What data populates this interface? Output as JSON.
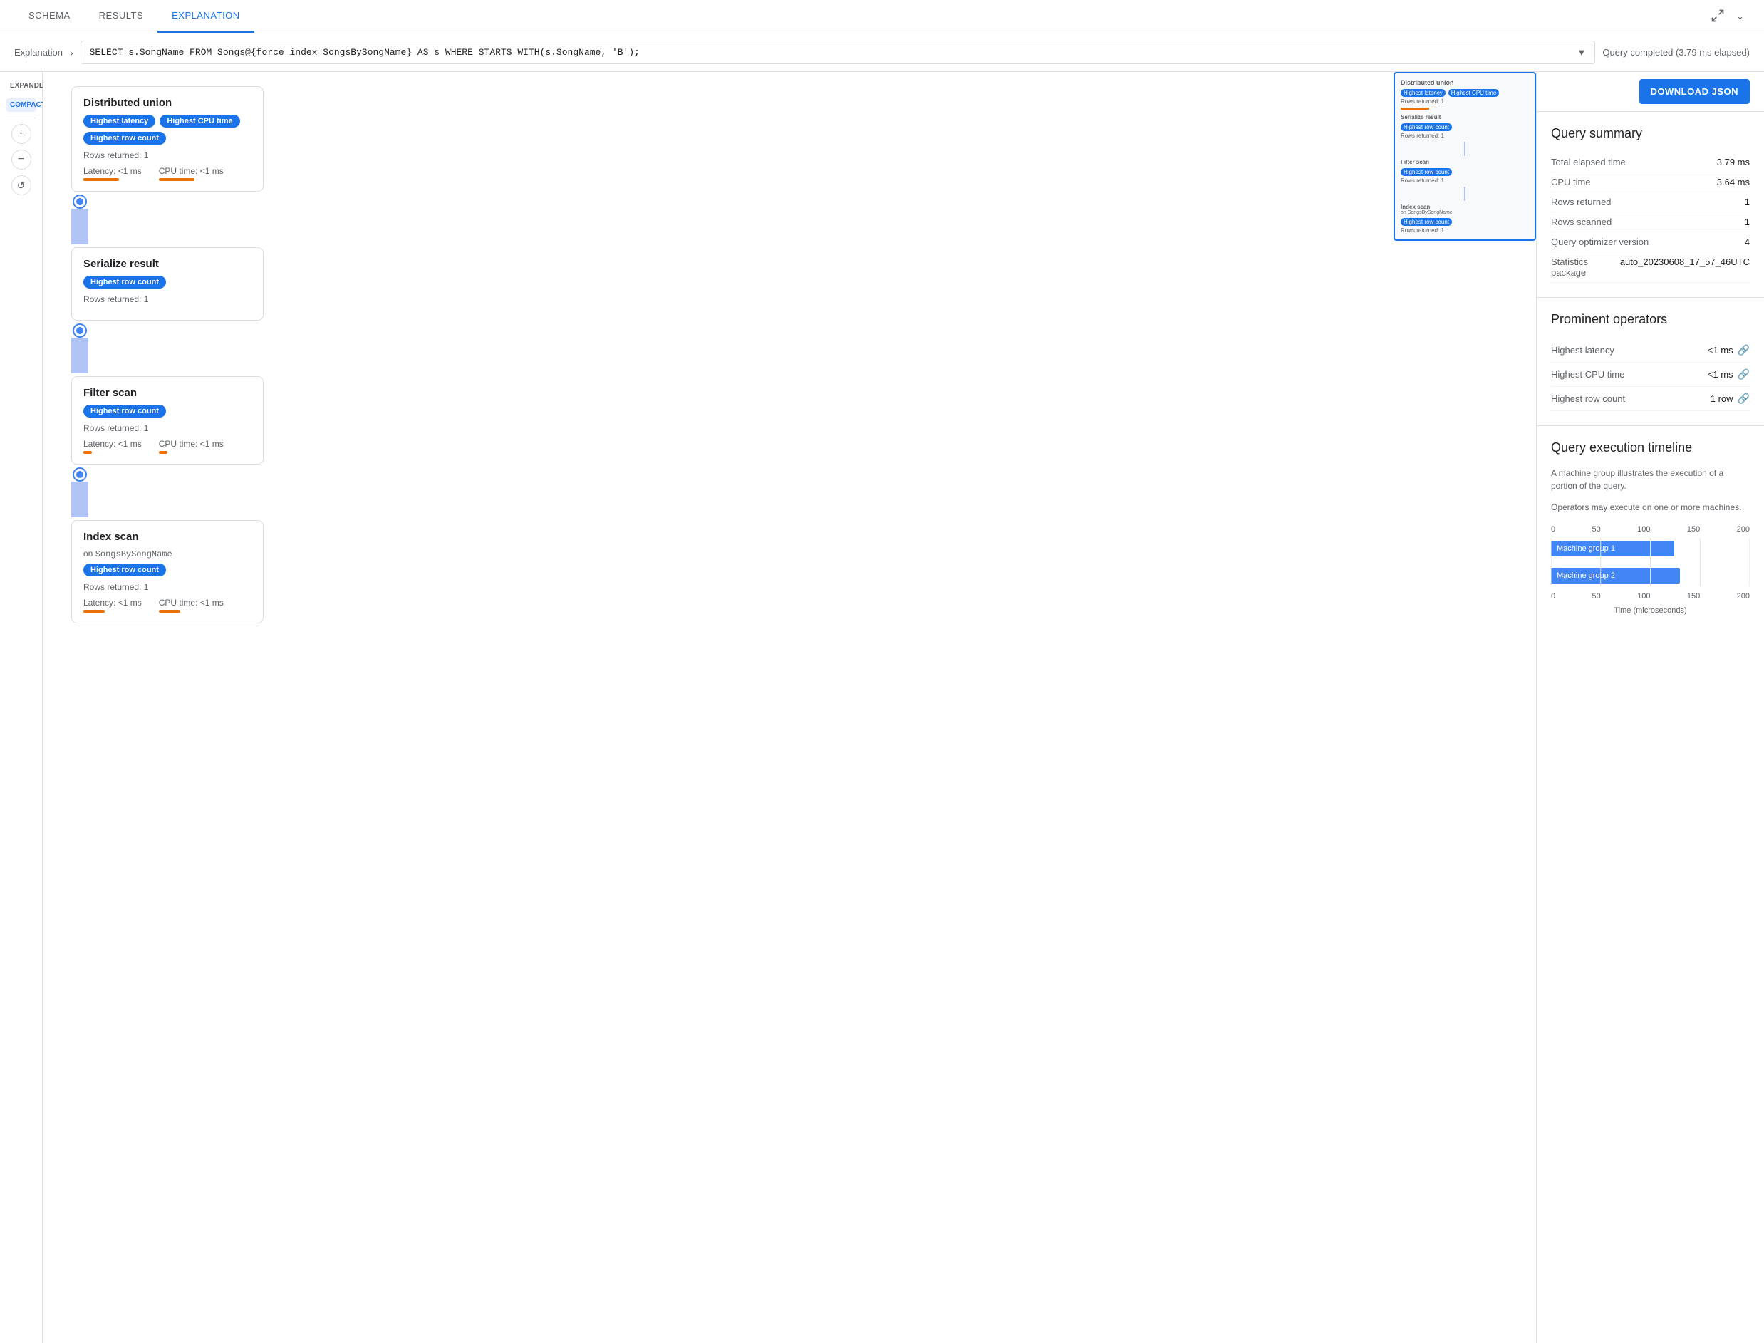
{
  "tabs": [
    {
      "id": "schema",
      "label": "SCHEMA"
    },
    {
      "id": "results",
      "label": "RESULTS"
    },
    {
      "id": "explanation",
      "label": "EXPLANATION",
      "active": true
    }
  ],
  "query_bar": {
    "breadcrumb": "Explanation",
    "query_text": "SELECT s.SongName FROM Songs@{force_index=SongsBySongName} AS s WHERE STARTS_WITH(s.SongName, 'B');",
    "status": "Query completed (3.79 ms elapsed)"
  },
  "view_modes": [
    {
      "id": "expanded",
      "label": "EXPANDED"
    },
    {
      "id": "compact",
      "label": "COMPACT",
      "active": true
    }
  ],
  "zoom": {
    "in_label": "+",
    "out_label": "−",
    "reset_label": "↺"
  },
  "nodes": [
    {
      "id": "distributed-union",
      "title": "Distributed union",
      "badges": [
        "Highest latency",
        "Highest CPU time",
        "Highest row count"
      ],
      "rows_label": "Rows returned: 1",
      "latency": "Latency: <1 ms",
      "cpu_time": "CPU time: <1 ms",
      "latency_bar_width": 50,
      "cpu_bar_width": 50
    },
    {
      "id": "serialize-result",
      "title": "Serialize result",
      "badges": [
        "Highest row count"
      ],
      "rows_label": "Rows returned: 1",
      "latency": null,
      "cpu_time": null
    },
    {
      "id": "filter-scan",
      "title": "Filter scan",
      "badges": [
        "Highest row count"
      ],
      "rows_label": "Rows returned: 1",
      "latency": "Latency: <1 ms",
      "cpu_time": "CPU time: <1 ms",
      "latency_bar_width": 12,
      "cpu_bar_width": 12
    },
    {
      "id": "index-scan",
      "title": "Index scan",
      "subtitle": "on SongsBySongName",
      "badges": [
        "Highest row count"
      ],
      "rows_label": "Rows returned: 1",
      "latency": "Latency: <1 ms",
      "cpu_time": "CPU time: <1 ms",
      "latency_bar_width": 30,
      "cpu_bar_width": 30
    }
  ],
  "download_btn": "DOWNLOAD JSON",
  "query_summary": {
    "title": "Query summary",
    "rows": [
      {
        "label": "Total elapsed time",
        "value": "3.79 ms"
      },
      {
        "label": "CPU time",
        "value": "3.64 ms"
      },
      {
        "label": "Rows returned",
        "value": "1"
      },
      {
        "label": "Rows scanned",
        "value": "1"
      },
      {
        "label": "Query optimizer version",
        "value": "4"
      },
      {
        "label": "Statistics package",
        "value": "auto_20230608_17_57_46UTC"
      }
    ]
  },
  "prominent_operators": {
    "title": "Prominent operators",
    "rows": [
      {
        "label": "Highest latency",
        "value": "<1 ms"
      },
      {
        "label": "Highest CPU time",
        "value": "<1 ms"
      },
      {
        "label": "Highest row count",
        "value": "1 row"
      }
    ]
  },
  "timeline": {
    "title": "Query execution timeline",
    "description1": "A machine group illustrates the execution of a portion of the query.",
    "description2": "Operators may execute on one or more machines.",
    "axis_labels": [
      "0",
      "50",
      "100",
      "150",
      "200"
    ],
    "bars": [
      {
        "label": "Machine group 1",
        "width_pct": 62
      },
      {
        "label": "Machine group 2",
        "width_pct": 65
      }
    ],
    "x_axis_label": "Time (microseconds)",
    "x_axis_labels_bottom": [
      "0",
      "50",
      "100",
      "150",
      "200"
    ]
  }
}
